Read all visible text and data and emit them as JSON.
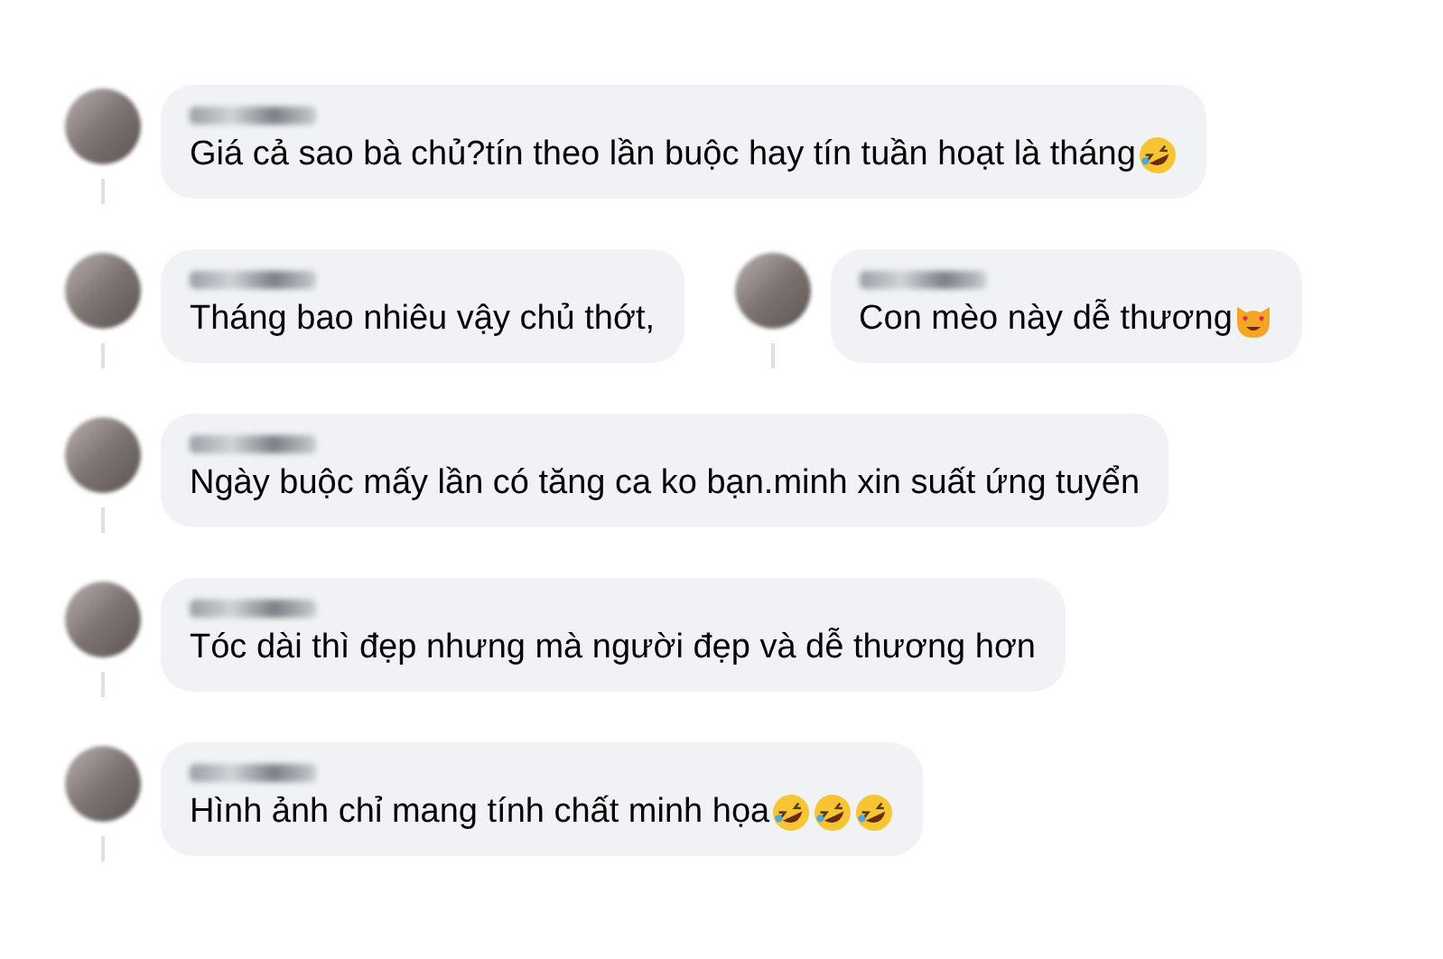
{
  "threads": [
    {
      "comments": [
        {
          "text": "Giá cả sao bà chủ?tín theo lần buộc hay tín tuần hoạt là tháng",
          "emojis": [
            {
              "kind": "rofl"
            }
          ]
        }
      ]
    },
    {
      "comments": [
        {
          "text": "Tháng bao nhiêu vậy chủ thớt,"
        },
        {
          "text": "Con mèo này dễ thương",
          "emojis": [
            {
              "kind": "heart-eyes-cat"
            }
          ]
        }
      ]
    },
    {
      "comments": [
        {
          "text": "Ngày buộc mấy lần có tăng ca ko bạn.minh xin suất ứng tuyển"
        }
      ]
    },
    {
      "comments": [
        {
          "text": "Tóc dài thì đẹp nhưng mà người đẹp và dễ thương hơn"
        }
      ]
    },
    {
      "comments": [
        {
          "text": "Hình ảnh chỉ mang tính chất minh họa",
          "emojis": [
            {
              "kind": "rofl"
            },
            {
              "kind": "rofl"
            },
            {
              "kind": "rofl"
            }
          ]
        }
      ]
    }
  ]
}
